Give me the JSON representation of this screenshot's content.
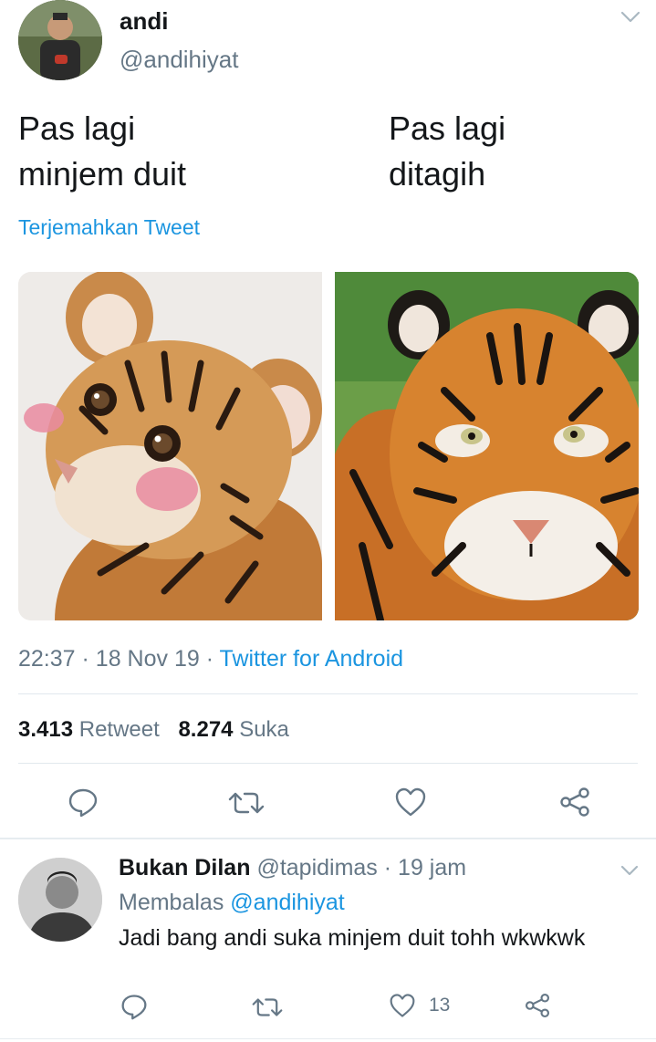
{
  "tweet": {
    "display_name": "andi",
    "handle": "@andihiyat",
    "text_left_line1": "Pas lagi",
    "text_left_line2": "minjem duit",
    "text_right_line1": "Pas lagi",
    "text_right_line2": "ditagih",
    "translate": "Terjemahkan Tweet",
    "time": "22:37",
    "dot1": "·",
    "date": "18 Nov 19",
    "dot2": "·",
    "client": "Twitter for Android",
    "retweet_count": "3.413",
    "retweet_label": "Retweet",
    "like_count": "8.274",
    "like_label": "Suka"
  },
  "reply": {
    "display_name": "Bukan Dilan",
    "handle": "@tapidimas",
    "dot": "·",
    "time": "19 jam",
    "replying_label": "Membalas",
    "replying_to": "@andihiyat",
    "text": "Jadi bang andi suka minjem duit tohh wkwkwk",
    "like_count": "13"
  },
  "icons": {
    "reply": "speech-bubble-icon",
    "retweet": "retweet-icon",
    "like": "heart-icon",
    "share": "share-icon",
    "menu": "chevron-down-icon"
  },
  "colors": {
    "link": "#1b95e0",
    "muted": "#657786",
    "text": "#14171a",
    "divider": "#e1e8ed"
  }
}
